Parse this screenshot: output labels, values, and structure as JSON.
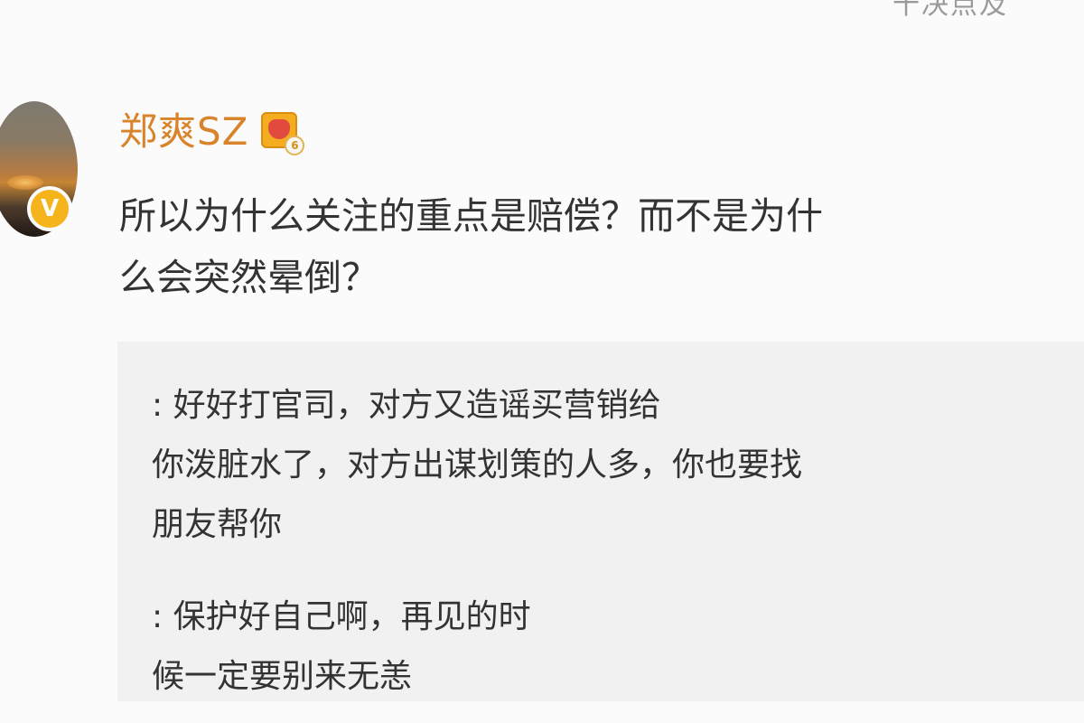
{
  "top_partial_text": "十决点及",
  "user": {
    "name": "郑爽SZ",
    "level_badge": "6",
    "verified_mark": "V"
  },
  "post": {
    "text": "所以为什么关注的重点是赔偿？而不是为什\n么会突然晕倒？"
  },
  "quotes": [
    {
      "text": "                  : 好好打官司，对方又造谣买营销给\n你泼脏水了，对方出谋划策的人多，你也要找\n朋友帮你"
    },
    {
      "text": "                                          : 保护好自己啊，再见的时\n候一定要别来无恙"
    }
  ]
}
